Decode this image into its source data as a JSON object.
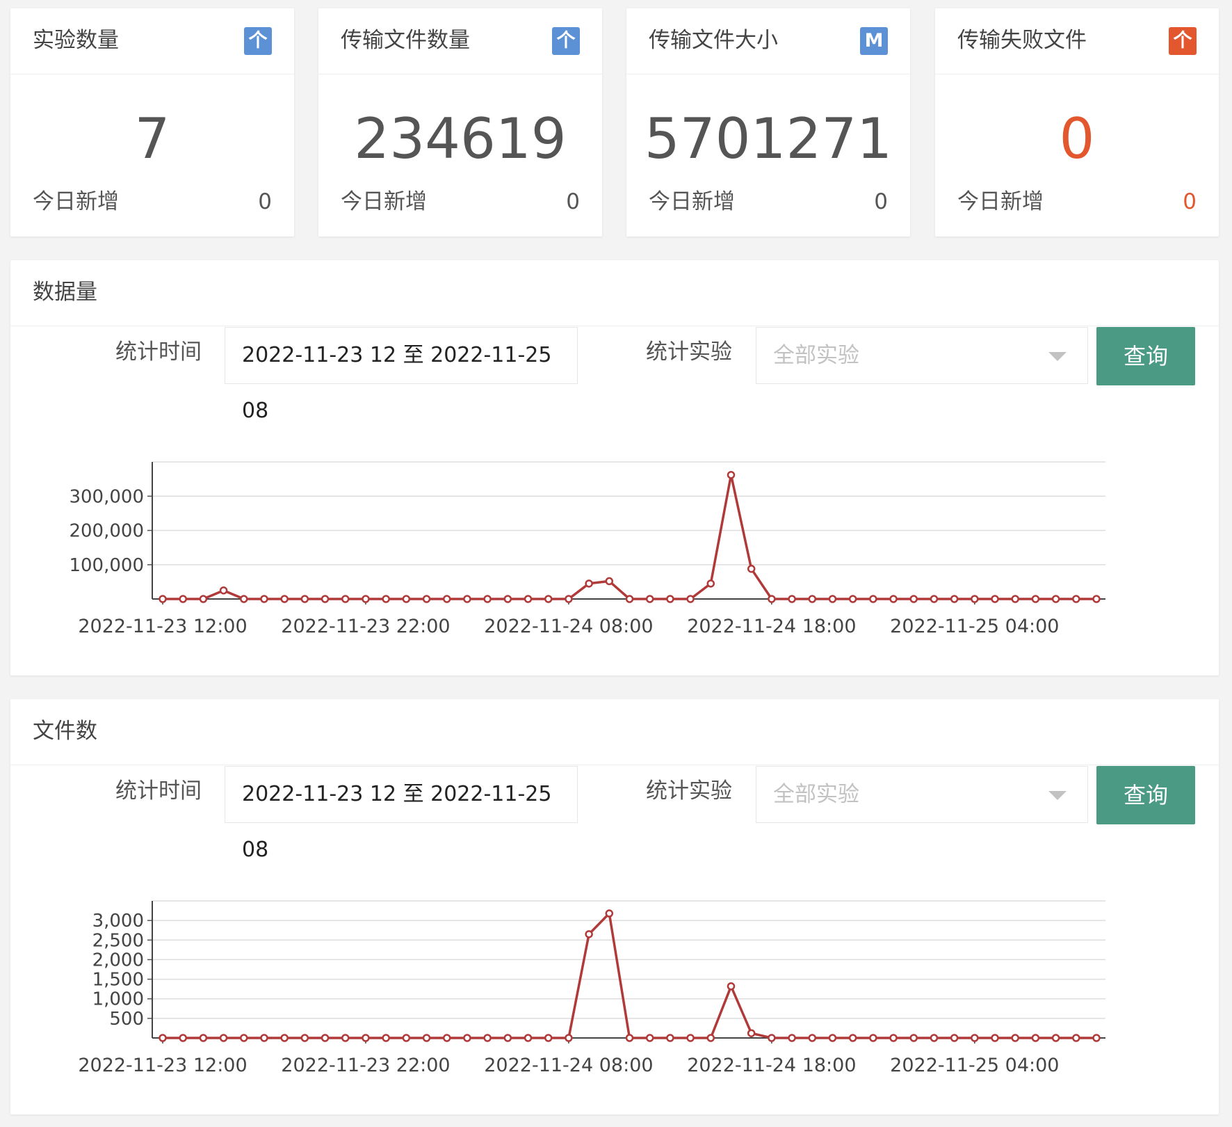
{
  "stats": [
    {
      "title": "实验数量",
      "badge": "个",
      "badge_color": "#5c91d6",
      "value": "7",
      "today_label": "今日新增",
      "today_value": "0",
      "accent": false
    },
    {
      "title": "传输文件数量",
      "badge": "个",
      "badge_color": "#5c91d6",
      "value": "234619",
      "today_label": "今日新增",
      "today_value": "0",
      "accent": false
    },
    {
      "title": "传输文件大小",
      "badge": "M",
      "badge_color": "#5c91d6",
      "value": "5701271",
      "today_label": "今日新增",
      "today_value": "0",
      "accent": false
    },
    {
      "title": "传输失败文件",
      "badge": "个",
      "badge_color": "#e2572e",
      "value": "0",
      "today_label": "今日新增",
      "today_value": "0",
      "accent": true
    }
  ],
  "panels": [
    {
      "title": "数据量",
      "time_label": "统计时间",
      "time_value": "2022-11-23 12 至 2022-11-25 08",
      "exp_label": "统计实验",
      "exp_placeholder": "全部实验",
      "query_label": "查询"
    },
    {
      "title": "文件数",
      "time_label": "统计时间",
      "time_value": "2022-11-23 12 至 2022-11-25 08",
      "exp_label": "统计实验",
      "exp_placeholder": "全部实验",
      "query_label": "查询"
    }
  ],
  "chart_data": [
    {
      "type": "line",
      "color": "#b03a3a",
      "y_ticks": [
        100000,
        200000,
        300000
      ],
      "y_tick_labels": [
        "100,000",
        "200,000",
        "300,000"
      ],
      "ylim": [
        0,
        400000
      ],
      "x_tick_labels": [
        "2022-11-23 12:00",
        "2022-11-23 22:00",
        "2022-11-24 08:00",
        "2022-11-24 18:00",
        "2022-11-25 04:00"
      ],
      "x_tick_indices": [
        0,
        10,
        20,
        30,
        40
      ],
      "values": [
        0,
        0,
        0,
        25000,
        0,
        0,
        0,
        0,
        0,
        0,
        0,
        0,
        0,
        0,
        0,
        0,
        0,
        0,
        0,
        0,
        0,
        45000,
        52000,
        0,
        0,
        0,
        0,
        45000,
        362000,
        88000,
        0,
        0,
        0,
        0,
        0,
        0,
        0,
        0,
        0,
        0,
        0,
        0,
        0,
        0,
        0,
        0,
        0
      ]
    },
    {
      "type": "line",
      "color": "#b03a3a",
      "y_ticks": [
        500,
        1000,
        1500,
        2000,
        2500,
        3000
      ],
      "y_tick_labels": [
        "500",
        "1,000",
        "1,500",
        "2,000",
        "2,500",
        "3,000"
      ],
      "ylim": [
        0,
        3500
      ],
      "x_tick_labels": [
        "2022-11-23 12:00",
        "2022-11-23 22:00",
        "2022-11-24 08:00",
        "2022-11-24 18:00",
        "2022-11-25 04:00"
      ],
      "x_tick_indices": [
        0,
        10,
        20,
        30,
        40
      ],
      "values": [
        0,
        0,
        0,
        0,
        0,
        0,
        0,
        0,
        0,
        0,
        0,
        0,
        0,
        0,
        0,
        0,
        0,
        0,
        0,
        0,
        0,
        2650,
        3180,
        0,
        0,
        0,
        0,
        0,
        1320,
        120,
        0,
        0,
        0,
        0,
        0,
        0,
        0,
        0,
        0,
        0,
        0,
        0,
        0,
        0,
        0,
        0,
        0
      ]
    }
  ]
}
